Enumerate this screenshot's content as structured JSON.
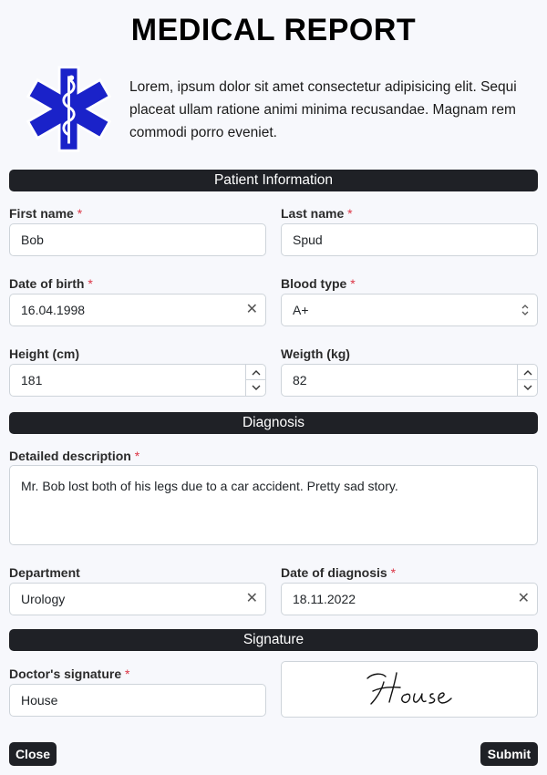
{
  "title": "MEDICAL REPORT",
  "intro": "Lorem, ipsum dolor sit amet consectetur adipisicing elit. Sequi placeat ullam ratione animi minima recusandae. Magnam rem commodi porro eveniet.",
  "sections": {
    "patient": "Patient Information",
    "diagnosis": "Diagnosis",
    "signature": "Signature"
  },
  "required_mark": "*",
  "fields": {
    "first_name": {
      "label": "First name",
      "value": "Bob"
    },
    "last_name": {
      "label": "Last name",
      "value": "Spud"
    },
    "dob": {
      "label": "Date of birth",
      "value": "16.04.1998"
    },
    "blood_type": {
      "label": "Blood type",
      "value": "A+"
    },
    "height": {
      "label": "Height (cm)",
      "value": "181"
    },
    "weight": {
      "label": "Weigth (kg)",
      "value": "82"
    },
    "description": {
      "label": "Detailed description",
      "value": "Mr. Bob lost both of his legs due to a car accident. Pretty sad story."
    },
    "department": {
      "label": "Department",
      "value": "Urology"
    },
    "diagnosis_date": {
      "label": "Date of diagnosis",
      "value": "18.11.2022"
    },
    "doctor_signature": {
      "label": "Doctor's signature",
      "value": "House"
    }
  },
  "signature_drawing": "House",
  "clear_glyph": "✕",
  "buttons": {
    "close": "Close",
    "submit": "Submit"
  },
  "colors": {
    "logo_blue": "#1a22c9",
    "section_bar": "#1f2126",
    "required": "#dc3545"
  }
}
